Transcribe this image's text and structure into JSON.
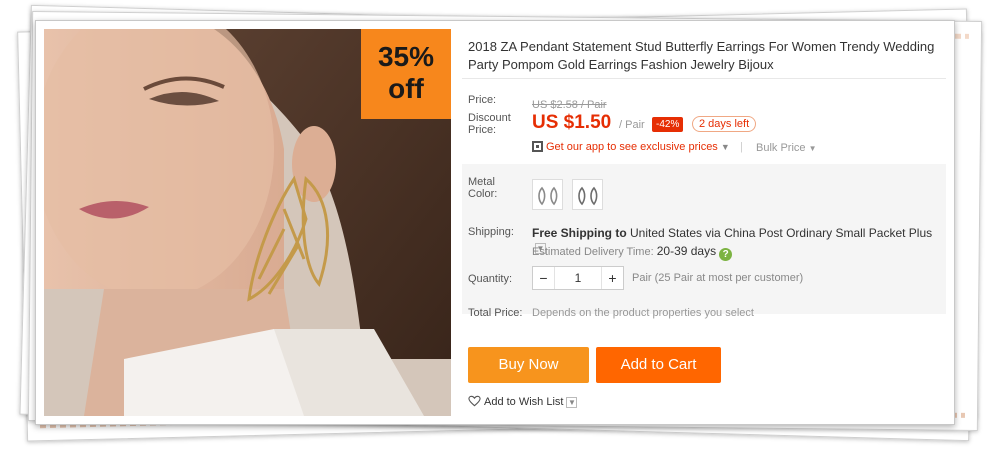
{
  "badge": {
    "line1": "35%",
    "line2": "off"
  },
  "product": {
    "title": "2018 ZA Pendant Statement Stud Butterfly Earrings For Women Trendy Wedding Party Pompom Gold Earrings Fashion Jewelry Bijoux"
  },
  "price": {
    "label": "Price:",
    "original": "US $2.58 / Pair",
    "discount_label": "Discount Price:",
    "current": "US $1.50",
    "unit": "/ Pair",
    "percent_off": "-42%",
    "time_left": "2 days left",
    "app_promo": "Get our app to see exclusive prices",
    "bulk_label": "Bulk Price"
  },
  "color": {
    "label": "Metal Color:",
    "options": [
      "butterfly-earring-silver",
      "butterfly-earring-gold"
    ]
  },
  "shipping": {
    "label": "Shipping:",
    "free_text": "Free Shipping to",
    "destination_text": "United States via China Post Ordinary Small Packet Plus",
    "eta_label": "Estimated Delivery Time:",
    "eta_value": "20-39 days"
  },
  "quantity": {
    "label": "Quantity:",
    "value": "1",
    "minus": "−",
    "plus": "+",
    "note": "Pair (25 Pair at most per customer)"
  },
  "total": {
    "label": "Total Price:",
    "note": "Depends on the product properties you select"
  },
  "actions": {
    "buy_now": "Buy Now",
    "add_to_cart": "Add to Cart",
    "wish_list": "Add to Wish List"
  },
  "colors": {
    "accent": "#e62e04",
    "buy_now": "#f7941d",
    "add_to_cart": "#ff6600",
    "badge": "#f7871c"
  }
}
